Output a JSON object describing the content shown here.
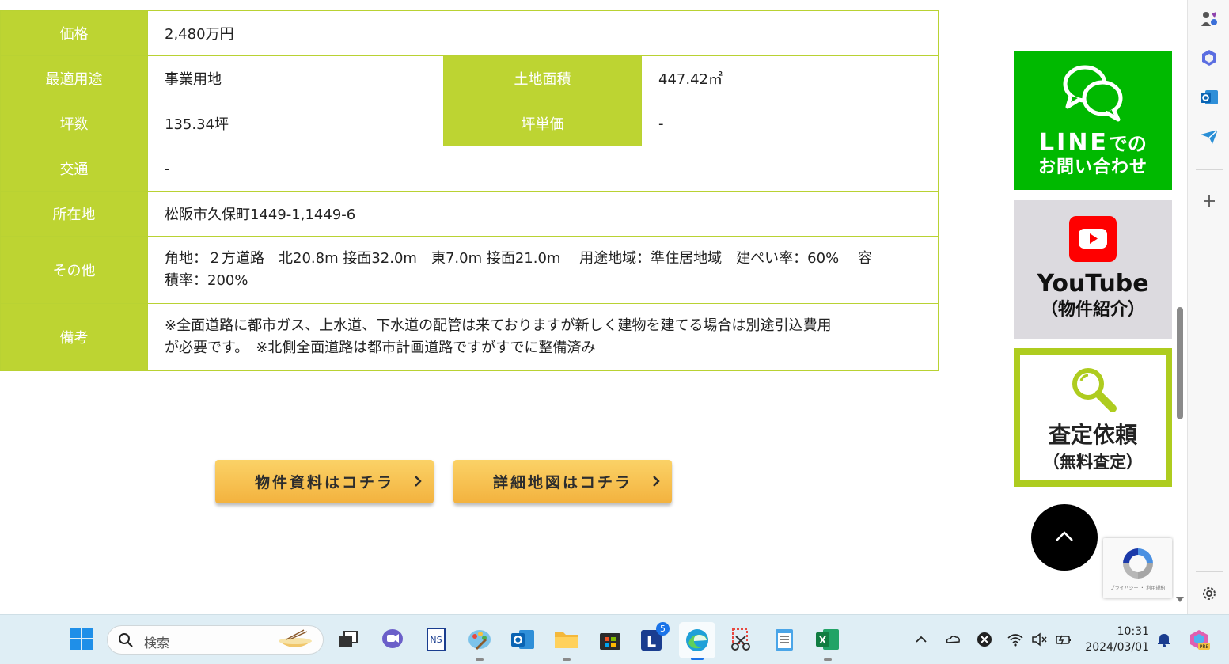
{
  "table": {
    "price_label": "価格",
    "price_value": "2,480万円",
    "use_label": "最適用途",
    "use_value": "事業用地",
    "area_label": "土地面積",
    "area_value": "447.42㎡",
    "tsubo_label": "坪数",
    "tsubo_value": "135.34坪",
    "unit_price_label": "坪単価",
    "unit_price_value": "-",
    "traffic_label": "交通",
    "traffic_value": "-",
    "address_label": "所在地",
    "address_value": "松阪市久保町1449-1,1449-6",
    "other_label": "その他",
    "other_value_line1": "角地：２方道路　北20.8m 接面32.0m　東7.0m 接面21.0m　 用途地域：準住居地域　建ぺい率：60%　 容",
    "other_value_line2": "積率：200%",
    "notes_label": "備考",
    "notes_value_line1": "※全面道路に都市ガス、上水道、下水道の配管は来ておりますが新しく建物を建てる場合は別途引込費用",
    "notes_value_line2": "が必要です。　※北側全面道路は都市計画道路ですがすでに整備済み"
  },
  "buttons": {
    "materials": "物件資料はコチラ",
    "map": "詳細地図はコチラ"
  },
  "banners": {
    "line_big": "LINE",
    "line_small": "での",
    "line_sub": "お問い合わせ",
    "youtube_title": "YouTube",
    "youtube_sub": "（物件紹介）",
    "satei_title": "査定依頼",
    "satei_sub": "（無料査定）"
  },
  "recaptcha": {
    "text": "プライバシー ・ 利用規約"
  },
  "taskbar": {
    "search_placeholder": "検索",
    "time": "10:31",
    "date": "2024/03/01",
    "l_badge": "5"
  },
  "colors": {
    "table_green": "#bdd432",
    "line_green": "#00b900",
    "satei_border": "#aecc1f",
    "button_orange": "#f3b23e"
  },
  "icons": {
    "line": "chat-bubbles-icon",
    "youtube": "youtube-play-icon",
    "satei": "magnifier-icon",
    "totop": "chevron-up-icon"
  }
}
